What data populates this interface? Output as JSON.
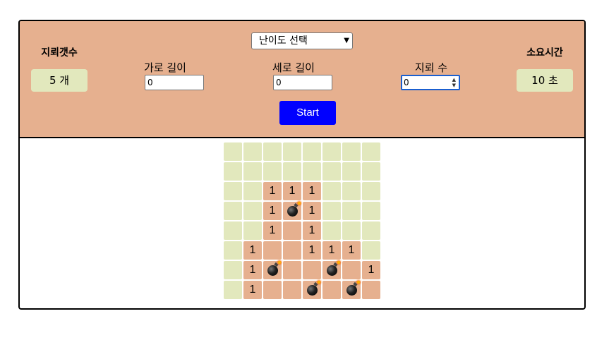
{
  "left_stat": {
    "title": "지뢰갯수",
    "value": "5 개"
  },
  "right_stat": {
    "title": "소요시간",
    "value": "10 초"
  },
  "difficulty": {
    "selected": "난이도 선택"
  },
  "fields": [
    {
      "label": "가로 길이",
      "value": "0"
    },
    {
      "label": "세로 길이",
      "value": "0"
    },
    {
      "label": "지뢰 수",
      "value": "0"
    }
  ],
  "start_label": "Start",
  "board": {
    "rows": 8,
    "cols": 8,
    "cells": [
      [
        "",
        "",
        "",
        "",
        "",
        "",
        "",
        ""
      ],
      [
        "",
        "",
        "",
        "",
        "",
        "",
        "",
        ""
      ],
      [
        "",
        "",
        "1",
        "1",
        "1",
        "",
        "",
        ""
      ],
      [
        "",
        "",
        "1",
        "*",
        "1",
        "",
        "",
        ""
      ],
      [
        "",
        "",
        "1",
        "o",
        "1",
        "",
        "",
        ""
      ],
      [
        "",
        "1",
        "o",
        "o",
        "1",
        "1",
        "1",
        ""
      ],
      [
        "",
        "1",
        "*",
        "o",
        "o",
        "*",
        "o",
        "1"
      ],
      [
        "",
        "1",
        "o",
        "o",
        "*",
        "o",
        "*",
        "o"
      ]
    ],
    "legend": {
      "": "hidden",
      "o": "revealed-empty",
      "*": "mine"
    }
  },
  "colors": {
    "panel": "#e6b08f",
    "hidden_cell": "#e2e8bd",
    "start_button": "#0000ff"
  }
}
